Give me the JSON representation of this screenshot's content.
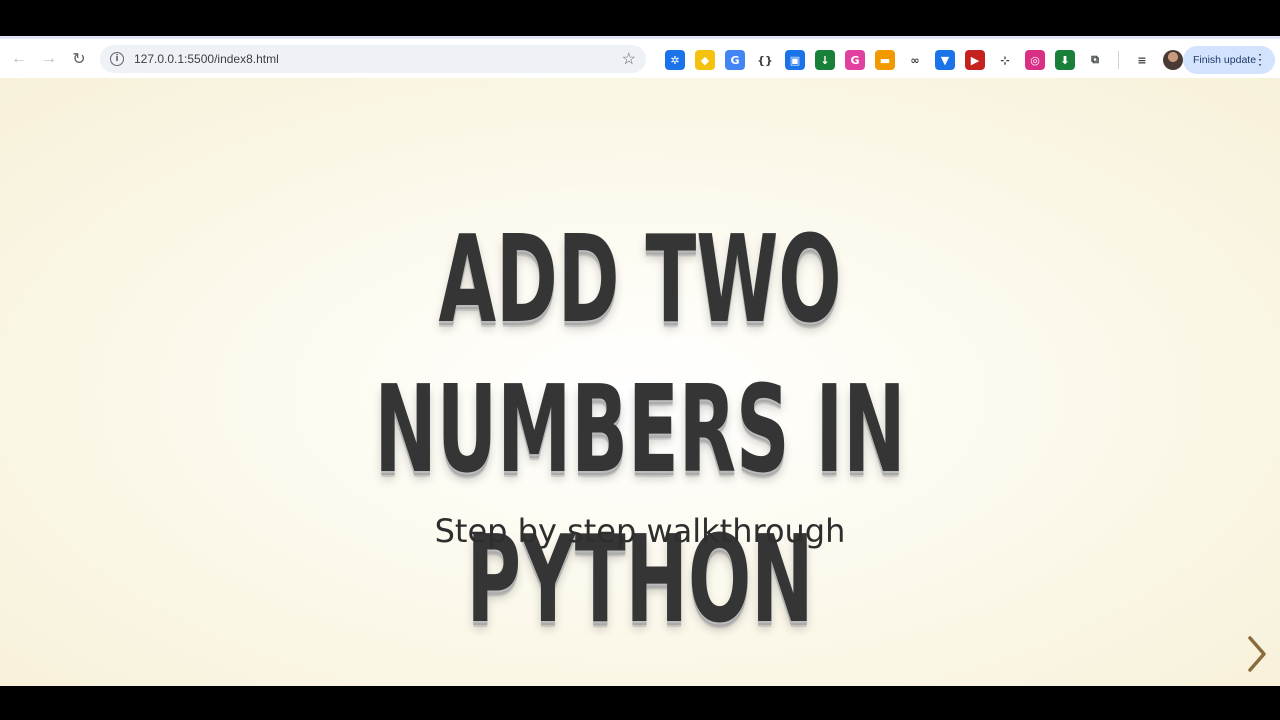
{
  "browser": {
    "url": "127.0.0.1:5500/index8.html",
    "update_button": "Finish update",
    "extensions": [
      {
        "name": "ext-blue-icon",
        "color": "#1a73e8",
        "glyph": "✲"
      },
      {
        "name": "ext-yellow-diamond-icon",
        "color": "#f4c20d",
        "glyph": "◆"
      },
      {
        "name": "ext-translate-icon",
        "color": "#4285f4",
        "glyph": "G"
      },
      {
        "name": "ext-brackets-icon",
        "color": "#ffffff",
        "glyph": "{}"
      },
      {
        "name": "ext-tv-icon",
        "color": "#1a73e8",
        "glyph": "▣"
      },
      {
        "name": "ext-green-download-icon",
        "color": "#188038",
        "glyph": "↓"
      },
      {
        "name": "ext-g-icon",
        "color": "#e040a0",
        "glyph": "G"
      },
      {
        "name": "ext-orange-icon",
        "color": "#f29900",
        "glyph": "▬"
      },
      {
        "name": "ext-infinity-icon",
        "color": "#ffffff",
        "glyph": "∞"
      },
      {
        "name": "ext-shield-icon",
        "color": "#1a73e8",
        "glyph": "▼"
      },
      {
        "name": "ext-red-play-icon",
        "color": "#c5221f",
        "glyph": "▶"
      },
      {
        "name": "ext-crop-icon",
        "color": "#ffffff",
        "glyph": "⊹"
      },
      {
        "name": "ext-pink-circle-icon",
        "color": "#d93085",
        "glyph": "◎"
      },
      {
        "name": "ext-green-arrow-icon",
        "color": "#188038",
        "glyph": "⬇"
      },
      {
        "name": "extensions-puzzle-icon",
        "color": "#ffffff",
        "glyph": "⧉"
      }
    ]
  },
  "slide": {
    "title": "ADD TWO NUMBERS IN\nPYTHON",
    "subtitle": "Step by step walkthrough",
    "accent_color": "#8b6b3d"
  }
}
